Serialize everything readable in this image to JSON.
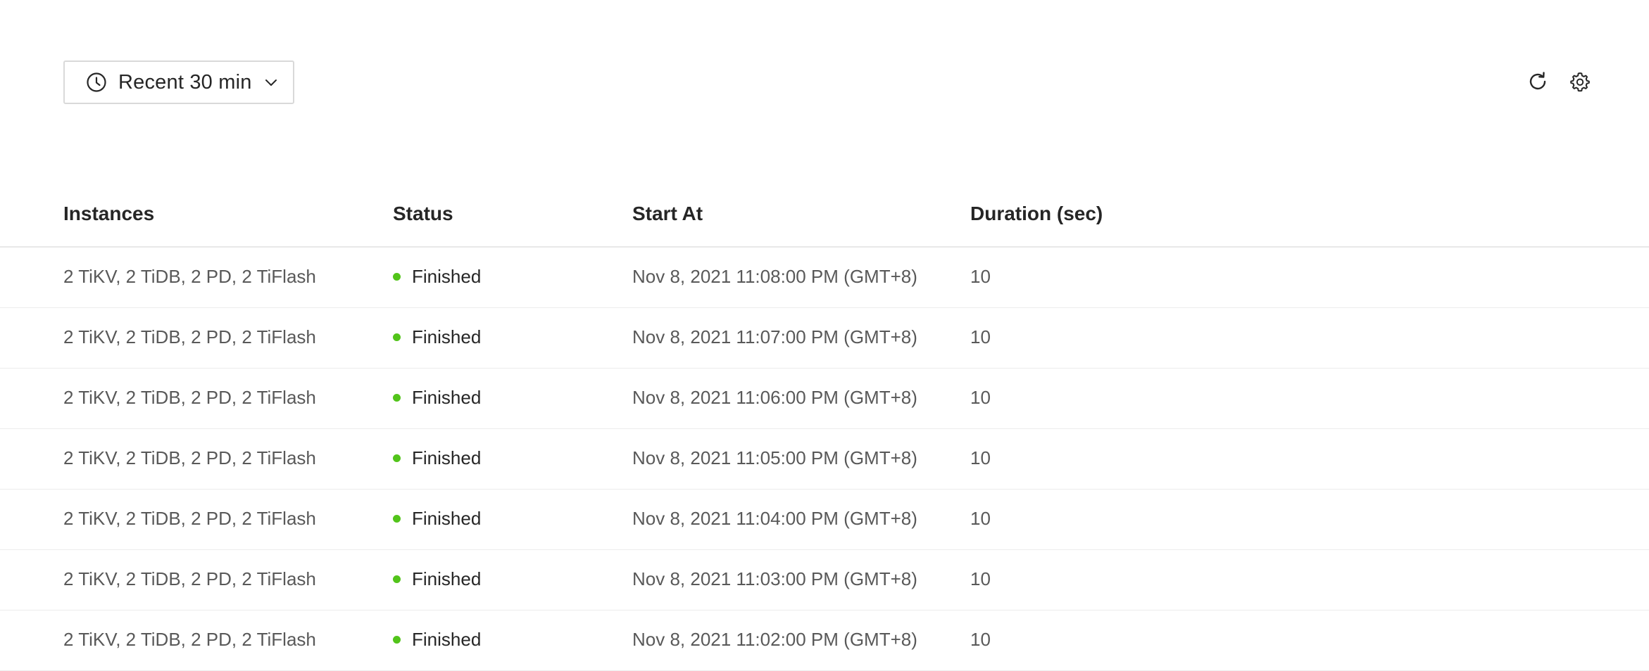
{
  "toolbar": {
    "time_range_label": "Recent 30 min",
    "icons": {
      "time_range": "clock-icon",
      "dropdown": "chevron-down-icon",
      "refresh": "refresh-icon",
      "settings": "gear-icon"
    }
  },
  "table": {
    "columns": [
      "Instances",
      "Status",
      "Start At",
      "Duration (sec)"
    ],
    "rows": [
      {
        "instances": "2 TiKV, 2 TiDB, 2 PD, 2 TiFlash",
        "status": "Finished",
        "start_at": "Nov 8, 2021 11:08:00 PM (GMT+8)",
        "duration": "10"
      },
      {
        "instances": "2 TiKV, 2 TiDB, 2 PD, 2 TiFlash",
        "status": "Finished",
        "start_at": "Nov 8, 2021 11:07:00 PM (GMT+8)",
        "duration": "10"
      },
      {
        "instances": "2 TiKV, 2 TiDB, 2 PD, 2 TiFlash",
        "status": "Finished",
        "start_at": "Nov 8, 2021 11:06:00 PM (GMT+8)",
        "duration": "10"
      },
      {
        "instances": "2 TiKV, 2 TiDB, 2 PD, 2 TiFlash",
        "status": "Finished",
        "start_at": "Nov 8, 2021 11:05:00 PM (GMT+8)",
        "duration": "10"
      },
      {
        "instances": "2 TiKV, 2 TiDB, 2 PD, 2 TiFlash",
        "status": "Finished",
        "start_at": "Nov 8, 2021 11:04:00 PM (GMT+8)",
        "duration": "10"
      },
      {
        "instances": "2 TiKV, 2 TiDB, 2 PD, 2 TiFlash",
        "status": "Finished",
        "start_at": "Nov 8, 2021 11:03:00 PM (GMT+8)",
        "duration": "10"
      },
      {
        "instances": "2 TiKV, 2 TiDB, 2 PD, 2 TiFlash",
        "status": "Finished",
        "start_at": "Nov 8, 2021 11:02:00 PM (GMT+8)",
        "duration": "10"
      }
    ]
  },
  "colors": {
    "status_finished": "#52c41a",
    "border": "#d9d9d9",
    "text_primary": "#262626",
    "text_secondary": "#595959"
  }
}
